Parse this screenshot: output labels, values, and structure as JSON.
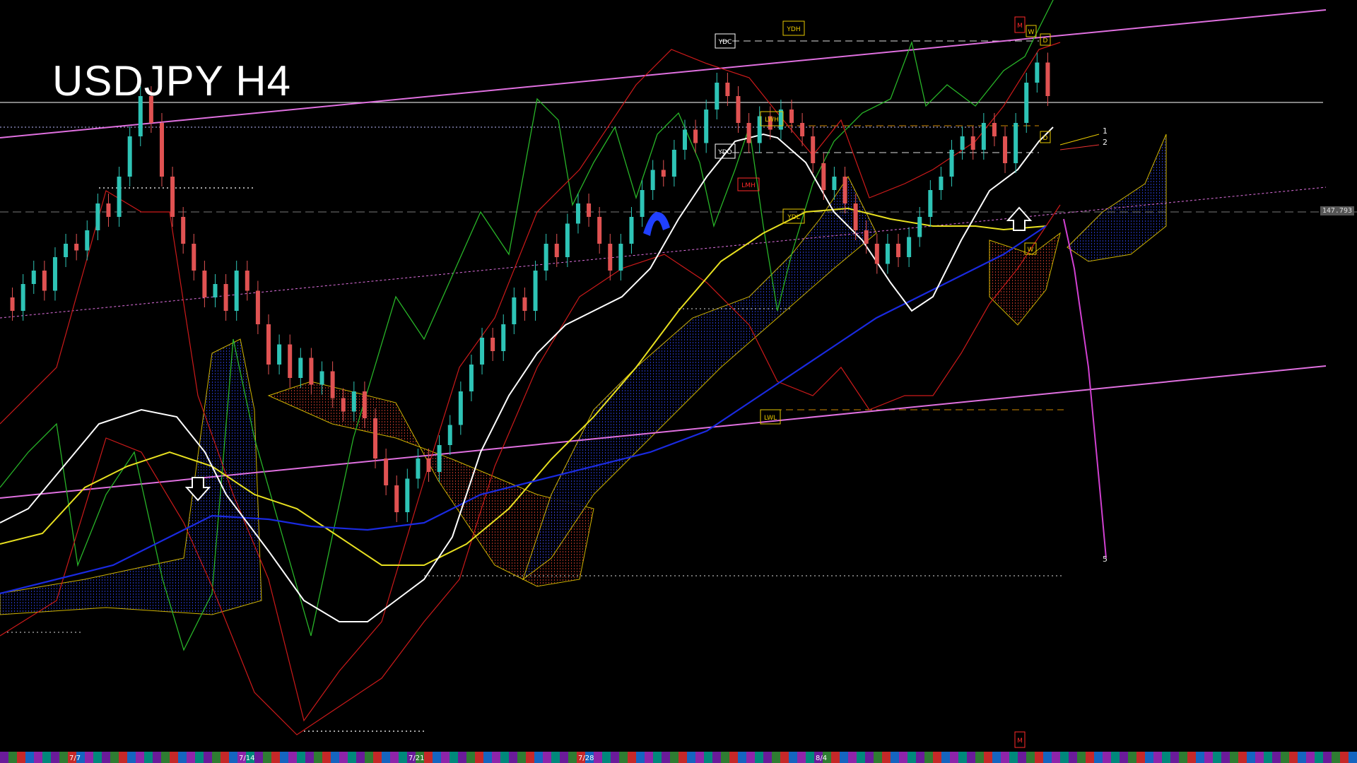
{
  "title": "USDJPY H4",
  "price_label": "147.793",
  "boxed_labels": [
    {
      "text": "YDC",
      "color": "#ffffff"
    },
    {
      "text": "YDH",
      "color": "#e6c700"
    },
    {
      "text": "M",
      "color": "#ff2a2a"
    },
    {
      "text": "W",
      "color": "#e6c700"
    },
    {
      "text": "D",
      "color": "#e6c700"
    },
    {
      "text": "LWH",
      "color": "#e6c700"
    },
    {
      "text": "YDO",
      "color": "#ffffff"
    },
    {
      "text": "LMH",
      "color": "#ff2a2a"
    },
    {
      "text": "YDL",
      "color": "#e6c700"
    },
    {
      "text": "D",
      "color": "#e6c700"
    },
    {
      "text": "W",
      "color": "#e6c700"
    },
    {
      "text": "LWL",
      "color": "#e6c700"
    },
    {
      "text": "M",
      "color": "#ff2a2a"
    }
  ],
  "wave_labels": [
    "1",
    "2",
    "5"
  ],
  "dates": [
    "7/7",
    "7/14",
    "7/21",
    "7/28",
    "8/4"
  ],
  "chart_data": {
    "type": "candlestick",
    "symbol": "USDJPY",
    "timeframe": "H4",
    "current_price": 147.793,
    "candles": [
      [
        0.62,
        0.6
      ],
      [
        0.6,
        0.64
      ],
      [
        0.64,
        0.66
      ],
      [
        0.66,
        0.63
      ],
      [
        0.63,
        0.68
      ],
      [
        0.68,
        0.7
      ],
      [
        0.7,
        0.69
      ],
      [
        0.69,
        0.72
      ],
      [
        0.72,
        0.76
      ],
      [
        0.76,
        0.74
      ],
      [
        0.74,
        0.8
      ],
      [
        0.8,
        0.86
      ],
      [
        0.86,
        0.92
      ],
      [
        0.92,
        0.88
      ],
      [
        0.88,
        0.8
      ],
      [
        0.8,
        0.74
      ],
      [
        0.74,
        0.7
      ],
      [
        0.7,
        0.66
      ],
      [
        0.66,
        0.62
      ],
      [
        0.62,
        0.64
      ],
      [
        0.64,
        0.6
      ],
      [
        0.6,
        0.66
      ],
      [
        0.66,
        0.63
      ],
      [
        0.63,
        0.58
      ],
      [
        0.58,
        0.52
      ],
      [
        0.52,
        0.55
      ],
      [
        0.55,
        0.5
      ],
      [
        0.5,
        0.53
      ],
      [
        0.53,
        0.49
      ],
      [
        0.49,
        0.51
      ],
      [
        0.51,
        0.47
      ],
      [
        0.47,
        0.45
      ],
      [
        0.45,
        0.48
      ],
      [
        0.48,
        0.44
      ],
      [
        0.44,
        0.38
      ],
      [
        0.38,
        0.34
      ],
      [
        0.34,
        0.3
      ],
      [
        0.3,
        0.35
      ],
      [
        0.35,
        0.38
      ],
      [
        0.38,
        0.36
      ],
      [
        0.36,
        0.4
      ],
      [
        0.4,
        0.43
      ],
      [
        0.43,
        0.48
      ],
      [
        0.48,
        0.52
      ],
      [
        0.52,
        0.56
      ],
      [
        0.56,
        0.54
      ],
      [
        0.54,
        0.58
      ],
      [
        0.58,
        0.62
      ],
      [
        0.62,
        0.6
      ],
      [
        0.6,
        0.66
      ],
      [
        0.66,
        0.7
      ],
      [
        0.7,
        0.68
      ],
      [
        0.68,
        0.73
      ],
      [
        0.73,
        0.76
      ],
      [
        0.76,
        0.74
      ],
      [
        0.74,
        0.7
      ],
      [
        0.7,
        0.66
      ],
      [
        0.66,
        0.7
      ],
      [
        0.7,
        0.74
      ],
      [
        0.74,
        0.78
      ],
      [
        0.78,
        0.81
      ],
      [
        0.81,
        0.8
      ],
      [
        0.8,
        0.84
      ],
      [
        0.84,
        0.87
      ],
      [
        0.87,
        0.85
      ],
      [
        0.85,
        0.9
      ],
      [
        0.9,
        0.94
      ],
      [
        0.94,
        0.92
      ],
      [
        0.92,
        0.88
      ],
      [
        0.88,
        0.85
      ],
      [
        0.85,
        0.89
      ],
      [
        0.89,
        0.87
      ],
      [
        0.87,
        0.9
      ],
      [
        0.9,
        0.88
      ],
      [
        0.88,
        0.86
      ],
      [
        0.86,
        0.82
      ],
      [
        0.82,
        0.78
      ],
      [
        0.78,
        0.8
      ],
      [
        0.8,
        0.76
      ],
      [
        0.76,
        0.72
      ],
      [
        0.72,
        0.7
      ],
      [
        0.7,
        0.67
      ],
      [
        0.67,
        0.7
      ],
      [
        0.7,
        0.68
      ],
      [
        0.68,
        0.71
      ],
      [
        0.71,
        0.74
      ],
      [
        0.74,
        0.78
      ],
      [
        0.78,
        0.8
      ],
      [
        0.8,
        0.84
      ],
      [
        0.84,
        0.86
      ],
      [
        0.86,
        0.84
      ],
      [
        0.84,
        0.88
      ],
      [
        0.88,
        0.86
      ],
      [
        0.86,
        0.82
      ],
      [
        0.82,
        0.88
      ],
      [
        0.88,
        0.94
      ],
      [
        0.94,
        0.97
      ],
      [
        0.97,
        0.92
      ]
    ]
  }
}
